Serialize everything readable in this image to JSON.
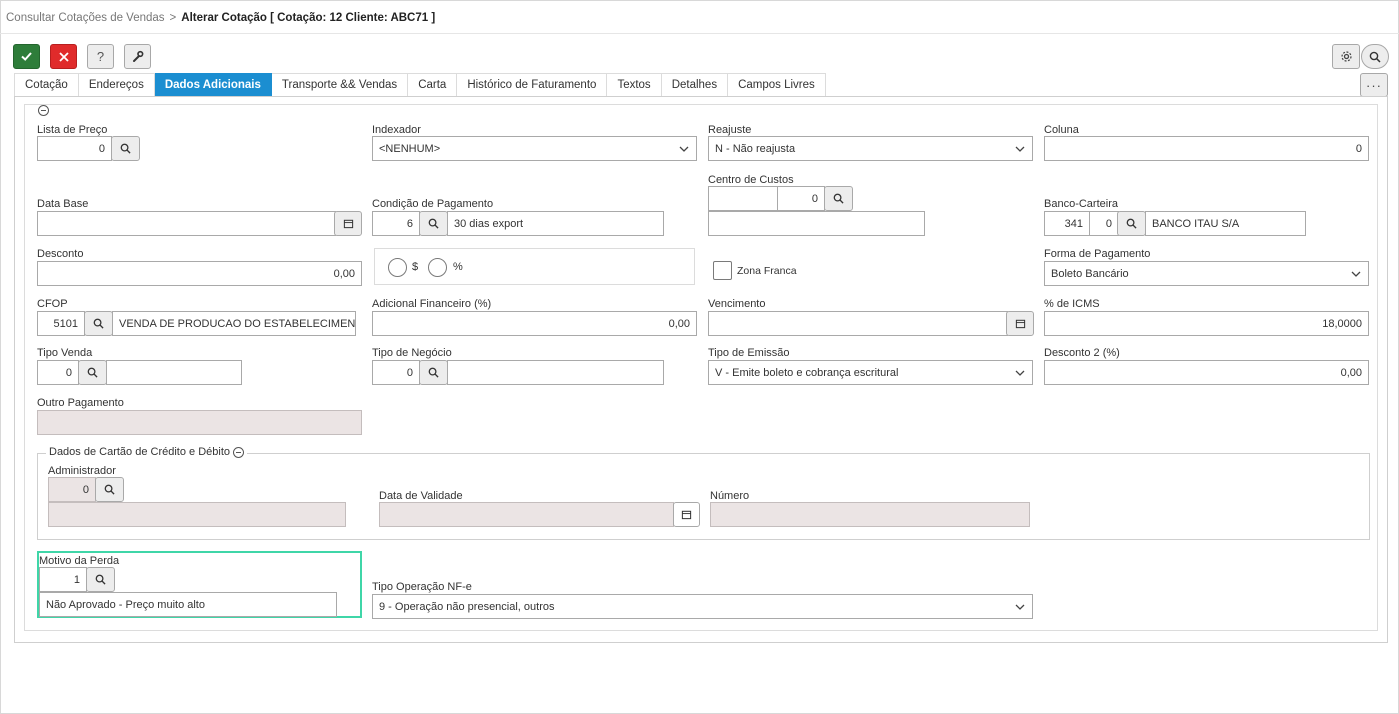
{
  "breadcrumb": {
    "parent": "Consultar Cotações de Vendas",
    "separator": ">",
    "current": "Alterar Cotação [ Cotação: 12 Cliente: ABC71 ]"
  },
  "toolbar": {
    "help_label": "?",
    "more_label": "···"
  },
  "tabs": [
    {
      "label": "Cotação"
    },
    {
      "label": "Endereços"
    },
    {
      "label": "Dados Adicionais"
    },
    {
      "label": "Transporte && Vendas"
    },
    {
      "label": "Carta"
    },
    {
      "label": "Histórico de Faturamento"
    },
    {
      "label": "Textos"
    },
    {
      "label": "Detalhes"
    },
    {
      "label": "Campos Livres"
    }
  ],
  "form": {
    "lista_preco": {
      "label": "Lista de Preço",
      "value": "0"
    },
    "indexador": {
      "label": "Indexador",
      "value": "<NENHUM>"
    },
    "reajuste": {
      "label": "Reajuste",
      "value": "N - Não reajusta"
    },
    "coluna": {
      "label": "Coluna",
      "value": "0"
    },
    "data_base": {
      "label": "Data Base",
      "value": ""
    },
    "condicao_pagamento": {
      "label": "Condição de Pagamento",
      "code": "6",
      "description": "30 dias export"
    },
    "centro_custos": {
      "label": "Centro de Custos",
      "code1": "",
      "code2": "0",
      "description": ""
    },
    "banco_carteira": {
      "label": "Banco-Carteira",
      "bank": "341",
      "wallet": "0",
      "description": "BANCO ITAU S/A"
    },
    "desconto": {
      "label": "Desconto",
      "value": "0,00"
    },
    "desconto_tipo": {
      "option_money": "$",
      "option_percent": "%"
    },
    "zona_franca": {
      "label": "Zona Franca"
    },
    "forma_pagamento": {
      "label": "Forma de Pagamento",
      "value": "Boleto Bancário"
    },
    "cfop": {
      "label": "CFOP",
      "code": "5101",
      "description": "VENDA DE PRODUCAO DO ESTABELECIMENTO"
    },
    "adicional_financeiro": {
      "label": "Adicional Financeiro (%)",
      "value": "0,00"
    },
    "vencimento": {
      "label": "Vencimento",
      "value": ""
    },
    "icms": {
      "label": "% de ICMS",
      "value": "18,0000"
    },
    "tipo_venda": {
      "label": "Tipo Venda",
      "code": "0",
      "description": ""
    },
    "tipo_negocio": {
      "label": "Tipo de Negócio",
      "code": "0",
      "description": ""
    },
    "tipo_emissao": {
      "label": "Tipo de Emissão",
      "value": "V - Emite boleto e cobrança escritural"
    },
    "desconto2": {
      "label": "Desconto 2 (%)",
      "value": "0,00"
    },
    "outro_pagamento": {
      "label": "Outro Pagamento",
      "value": ""
    },
    "cartao": {
      "legend": "Dados de Cartão de Crédito e Débito",
      "administrador": {
        "label": "Administrador",
        "code": "0",
        "description": ""
      },
      "data_validade": {
        "label": "Data de Validade",
        "value": ""
      },
      "numero": {
        "label": "Número",
        "value": ""
      }
    },
    "motivo_perda": {
      "label": "Motivo da Perda",
      "code": "1",
      "description": "Não Aprovado - Preço muito alto"
    },
    "tipo_operacao_nfe": {
      "label": "Tipo Operação NF-e",
      "value": "9 - Operação não presencial, outros"
    }
  },
  "colors": {
    "accent": "#1b8ed1",
    "confirm": "#2e7d3a",
    "cancel": "#e02b2b",
    "highlight": "#3fd6a8",
    "disabled_field": "#ebe4e4"
  }
}
